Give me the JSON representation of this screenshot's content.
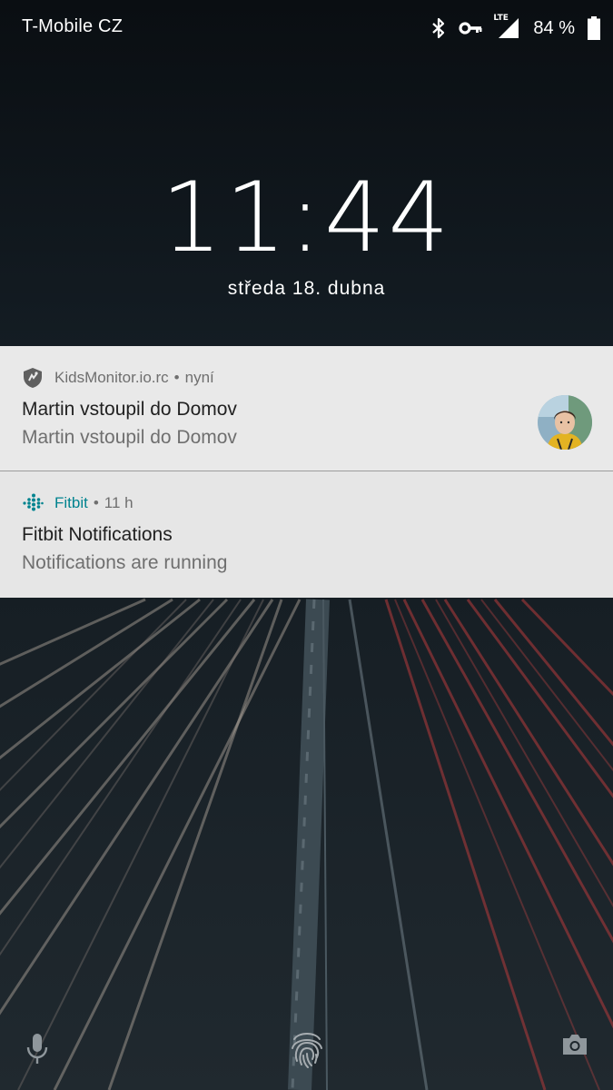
{
  "status_bar": {
    "carrier": "T-Mobile CZ",
    "network": "LTE",
    "battery_percent": "84 %",
    "battery_level": 0.84,
    "icons": [
      "bluetooth-icon",
      "vpn-key-icon",
      "lte-signal-icon",
      "battery-icon"
    ]
  },
  "lockscreen": {
    "time": "11:44",
    "date": "středa 18. dubna"
  },
  "notifications": [
    {
      "app_icon": "shield-icon",
      "app_name": "KidsMonitor.io.rc",
      "separator": "•",
      "time": "nyní",
      "title": "Martin vstoupil do Domov",
      "text": "Martin vstoupil do Domov",
      "has_avatar": true
    },
    {
      "app_icon": "fitbit-icon",
      "app_name": "Fitbit",
      "separator": "•",
      "time": "11 h",
      "title": "Fitbit Notifications",
      "text": "Notifications are running",
      "accent_color": "#00838f"
    }
  ],
  "bottom_actions": {
    "left": "mic-icon",
    "center": "fingerprint-icon",
    "right": "camera-icon"
  }
}
